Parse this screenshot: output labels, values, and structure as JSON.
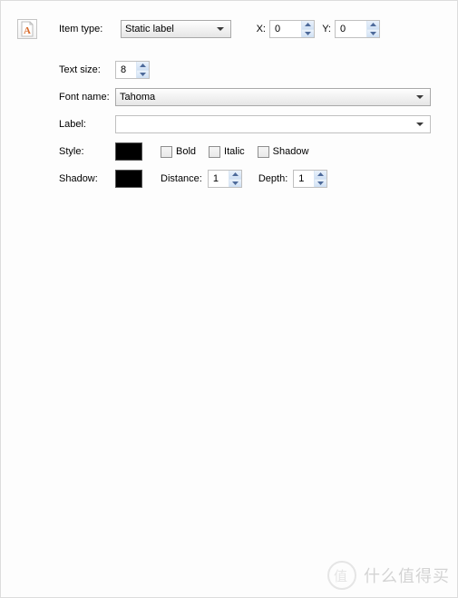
{
  "header": {
    "item_type_label": "Item type:",
    "item_type_value": "Static label",
    "x_label": "X:",
    "x_value": "0",
    "y_label": "Y:",
    "y_value": "0"
  },
  "text_size": {
    "label": "Text size:",
    "value": "8"
  },
  "font_name": {
    "label": "Font name:",
    "value": "Tahoma"
  },
  "label_field": {
    "label": "Label:",
    "value": ""
  },
  "style": {
    "label": "Style:",
    "swatch_color": "#000000",
    "bold": "Bold",
    "italic": "Italic",
    "shadow": "Shadow"
  },
  "shadow": {
    "label": "Shadow:",
    "swatch_color": "#000000",
    "distance_label": "Distance:",
    "distance_value": "1",
    "depth_label": "Depth:",
    "depth_value": "1"
  },
  "watermark_text": "什么值得买"
}
